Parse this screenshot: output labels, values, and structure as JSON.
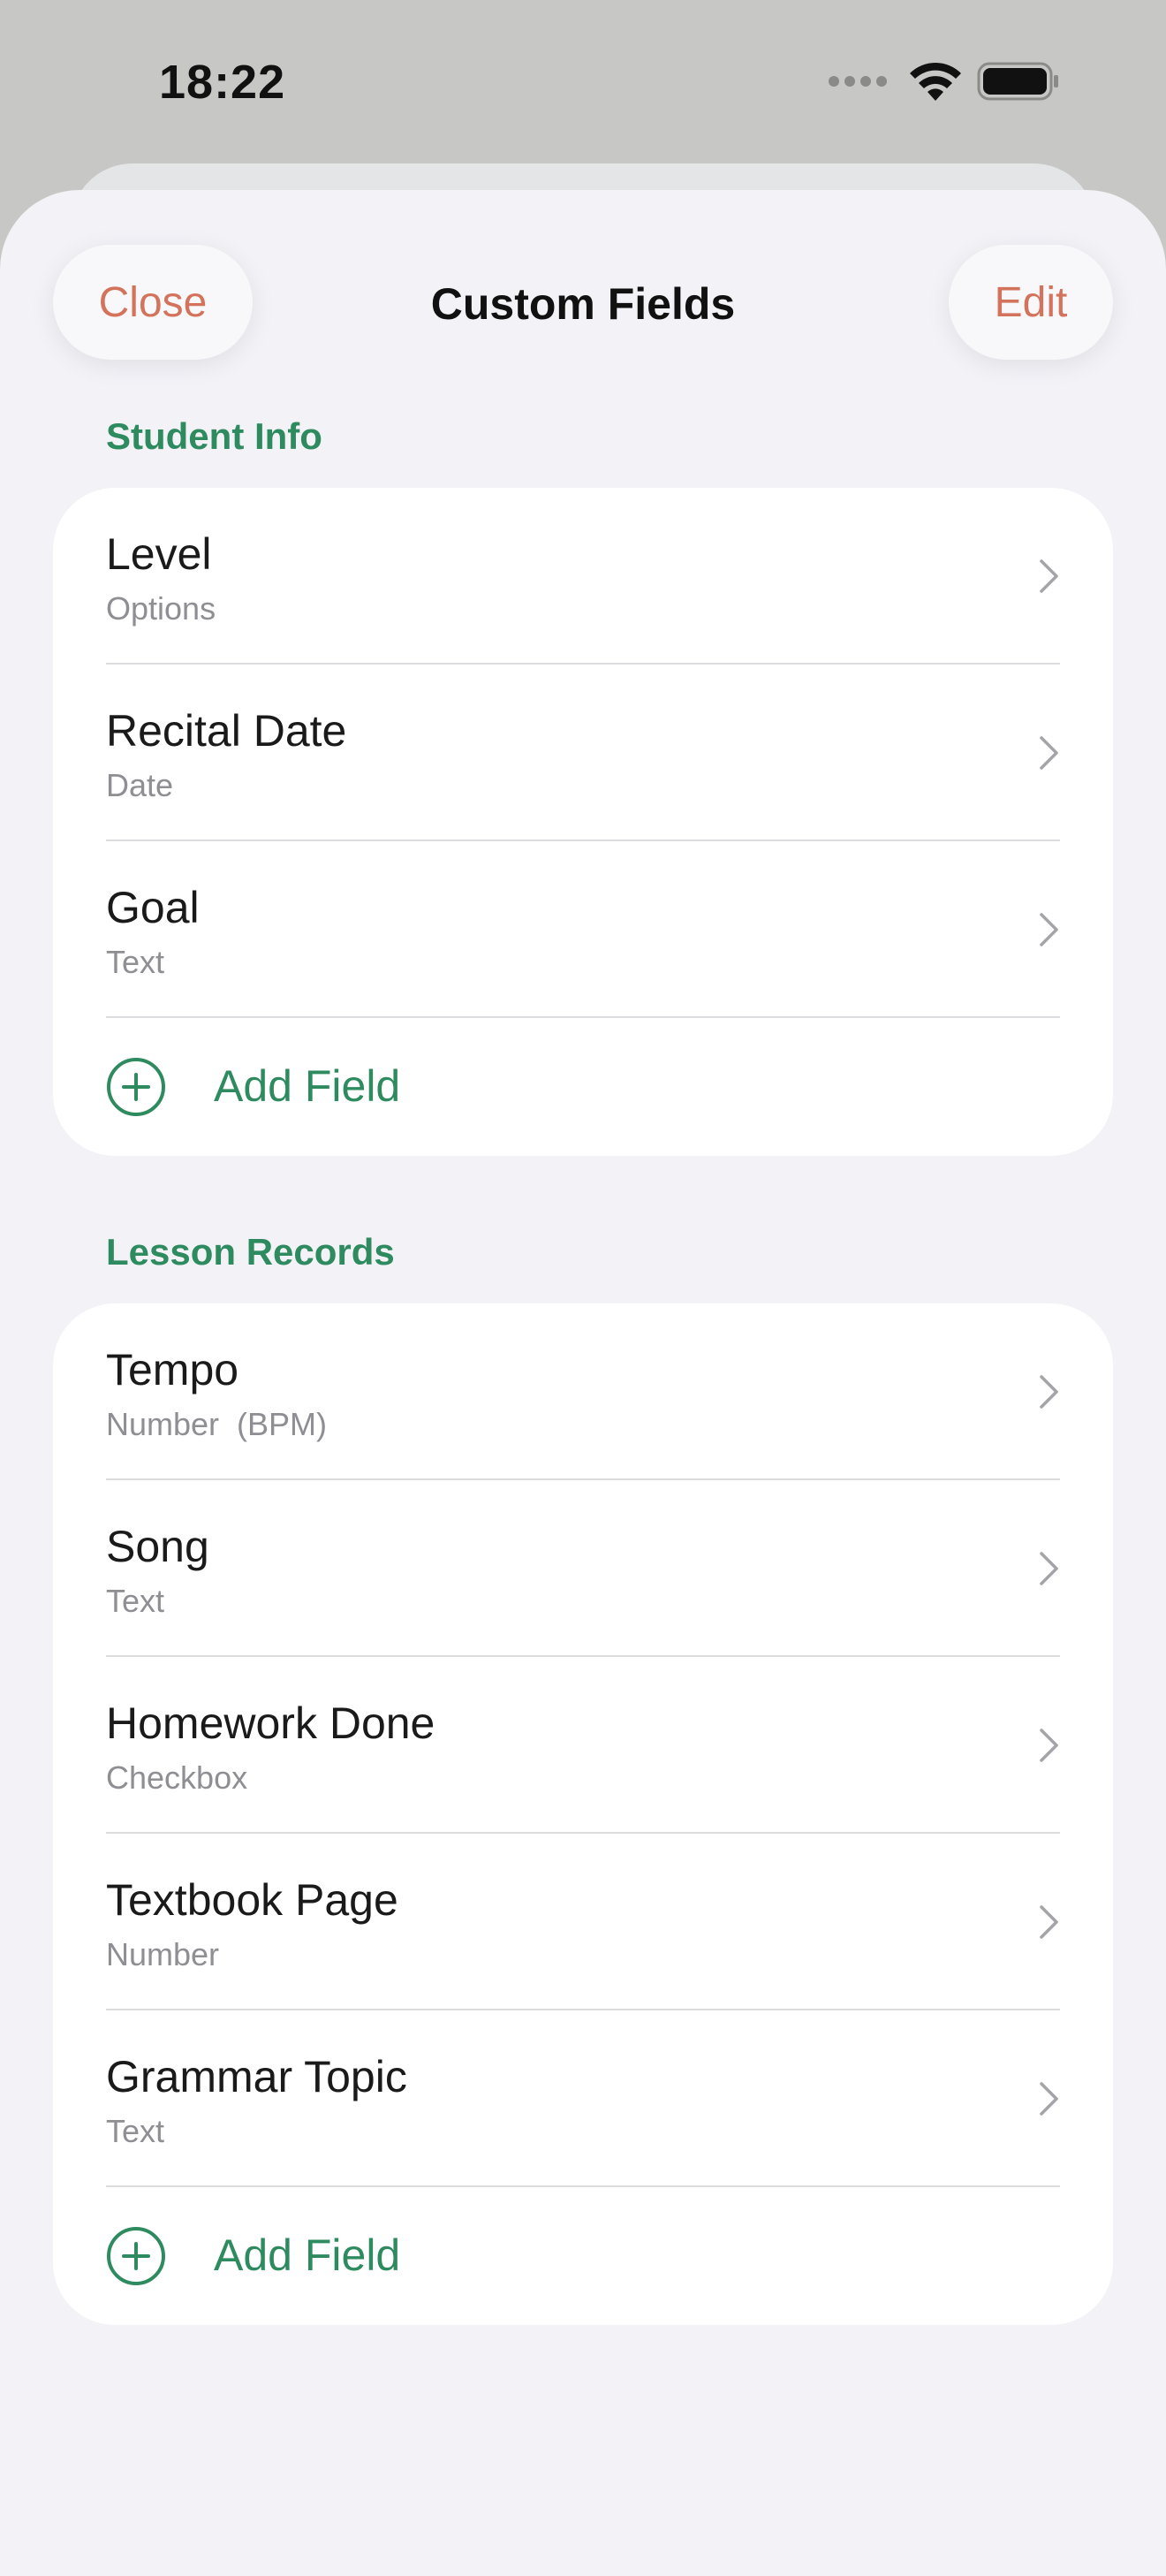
{
  "status_bar": {
    "time": "18:22"
  },
  "nav": {
    "close_label": "Close",
    "title": "Custom Fields",
    "edit_label": "Edit"
  },
  "sections": [
    {
      "header": "Student Info",
      "fields": [
        {
          "name": "Level",
          "type": "Options"
        },
        {
          "name": "Recital Date",
          "type": "Date"
        },
        {
          "name": "Goal",
          "type": "Text"
        }
      ],
      "add_label": "Add Field"
    },
    {
      "header": "Lesson Records",
      "fields": [
        {
          "name": "Tempo",
          "type": "Number  (BPM)"
        },
        {
          "name": "Song",
          "type": "Text"
        },
        {
          "name": "Homework Done",
          "type": "Checkbox"
        },
        {
          "name": "Textbook Page",
          "type": "Number"
        },
        {
          "name": "Grammar Topic",
          "type": "Text"
        }
      ],
      "add_label": "Add Field"
    }
  ],
  "icons": {
    "chevron": "chevron-right-icon",
    "add": "plus-circle-icon",
    "wifi": "wifi-icon",
    "battery": "battery-icon",
    "signal": "signal-icon"
  },
  "colors": {
    "accent_green": "#2e8a5f",
    "nav_button_text": "#d4735c",
    "secondary_text": "#8e8e93",
    "sheet_background": "#f2f2f7"
  }
}
